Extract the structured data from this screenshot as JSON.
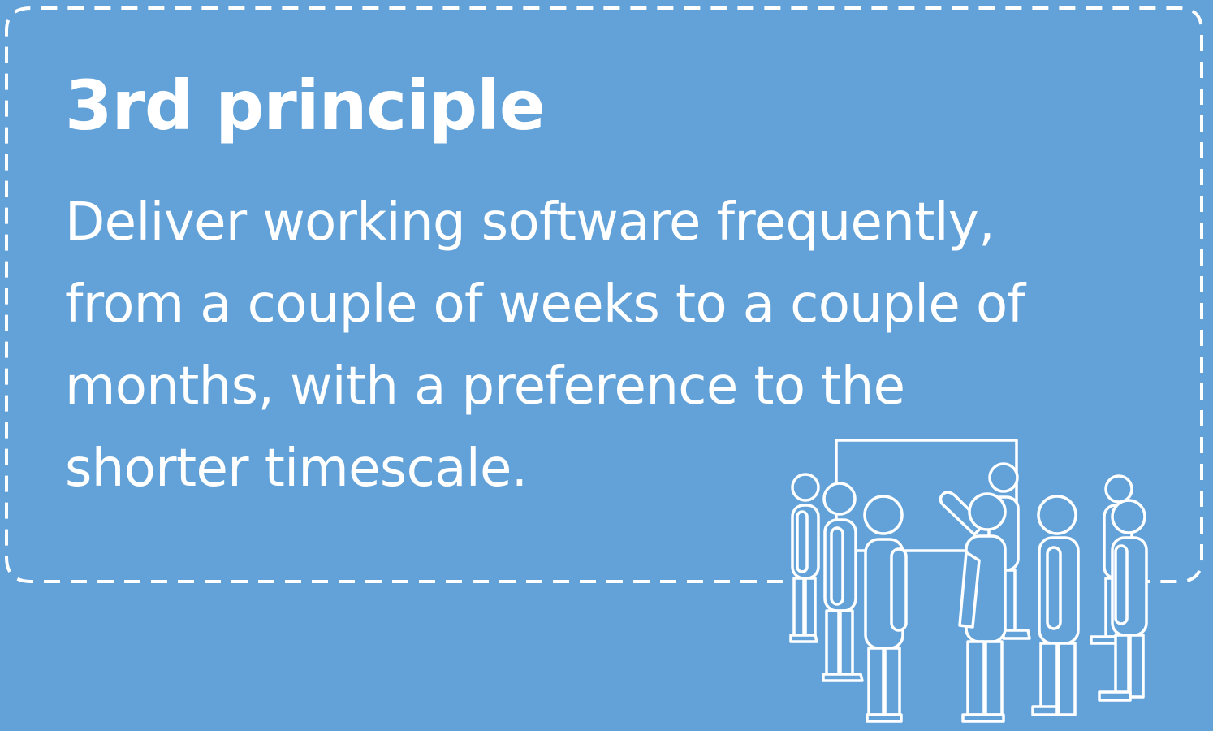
{
  "slide": {
    "title": "3rd principle",
    "body_lines": [
      "Deliver working software frequently,",
      "from a couple of weeks to a couple of",
      "months, with a preference to the",
      "shorter timescale."
    ]
  },
  "colors": {
    "background": "#62a2d8",
    "foreground": "#ffffff"
  },
  "illustration": {
    "icon": "team-meeting-whiteboard-icon"
  }
}
